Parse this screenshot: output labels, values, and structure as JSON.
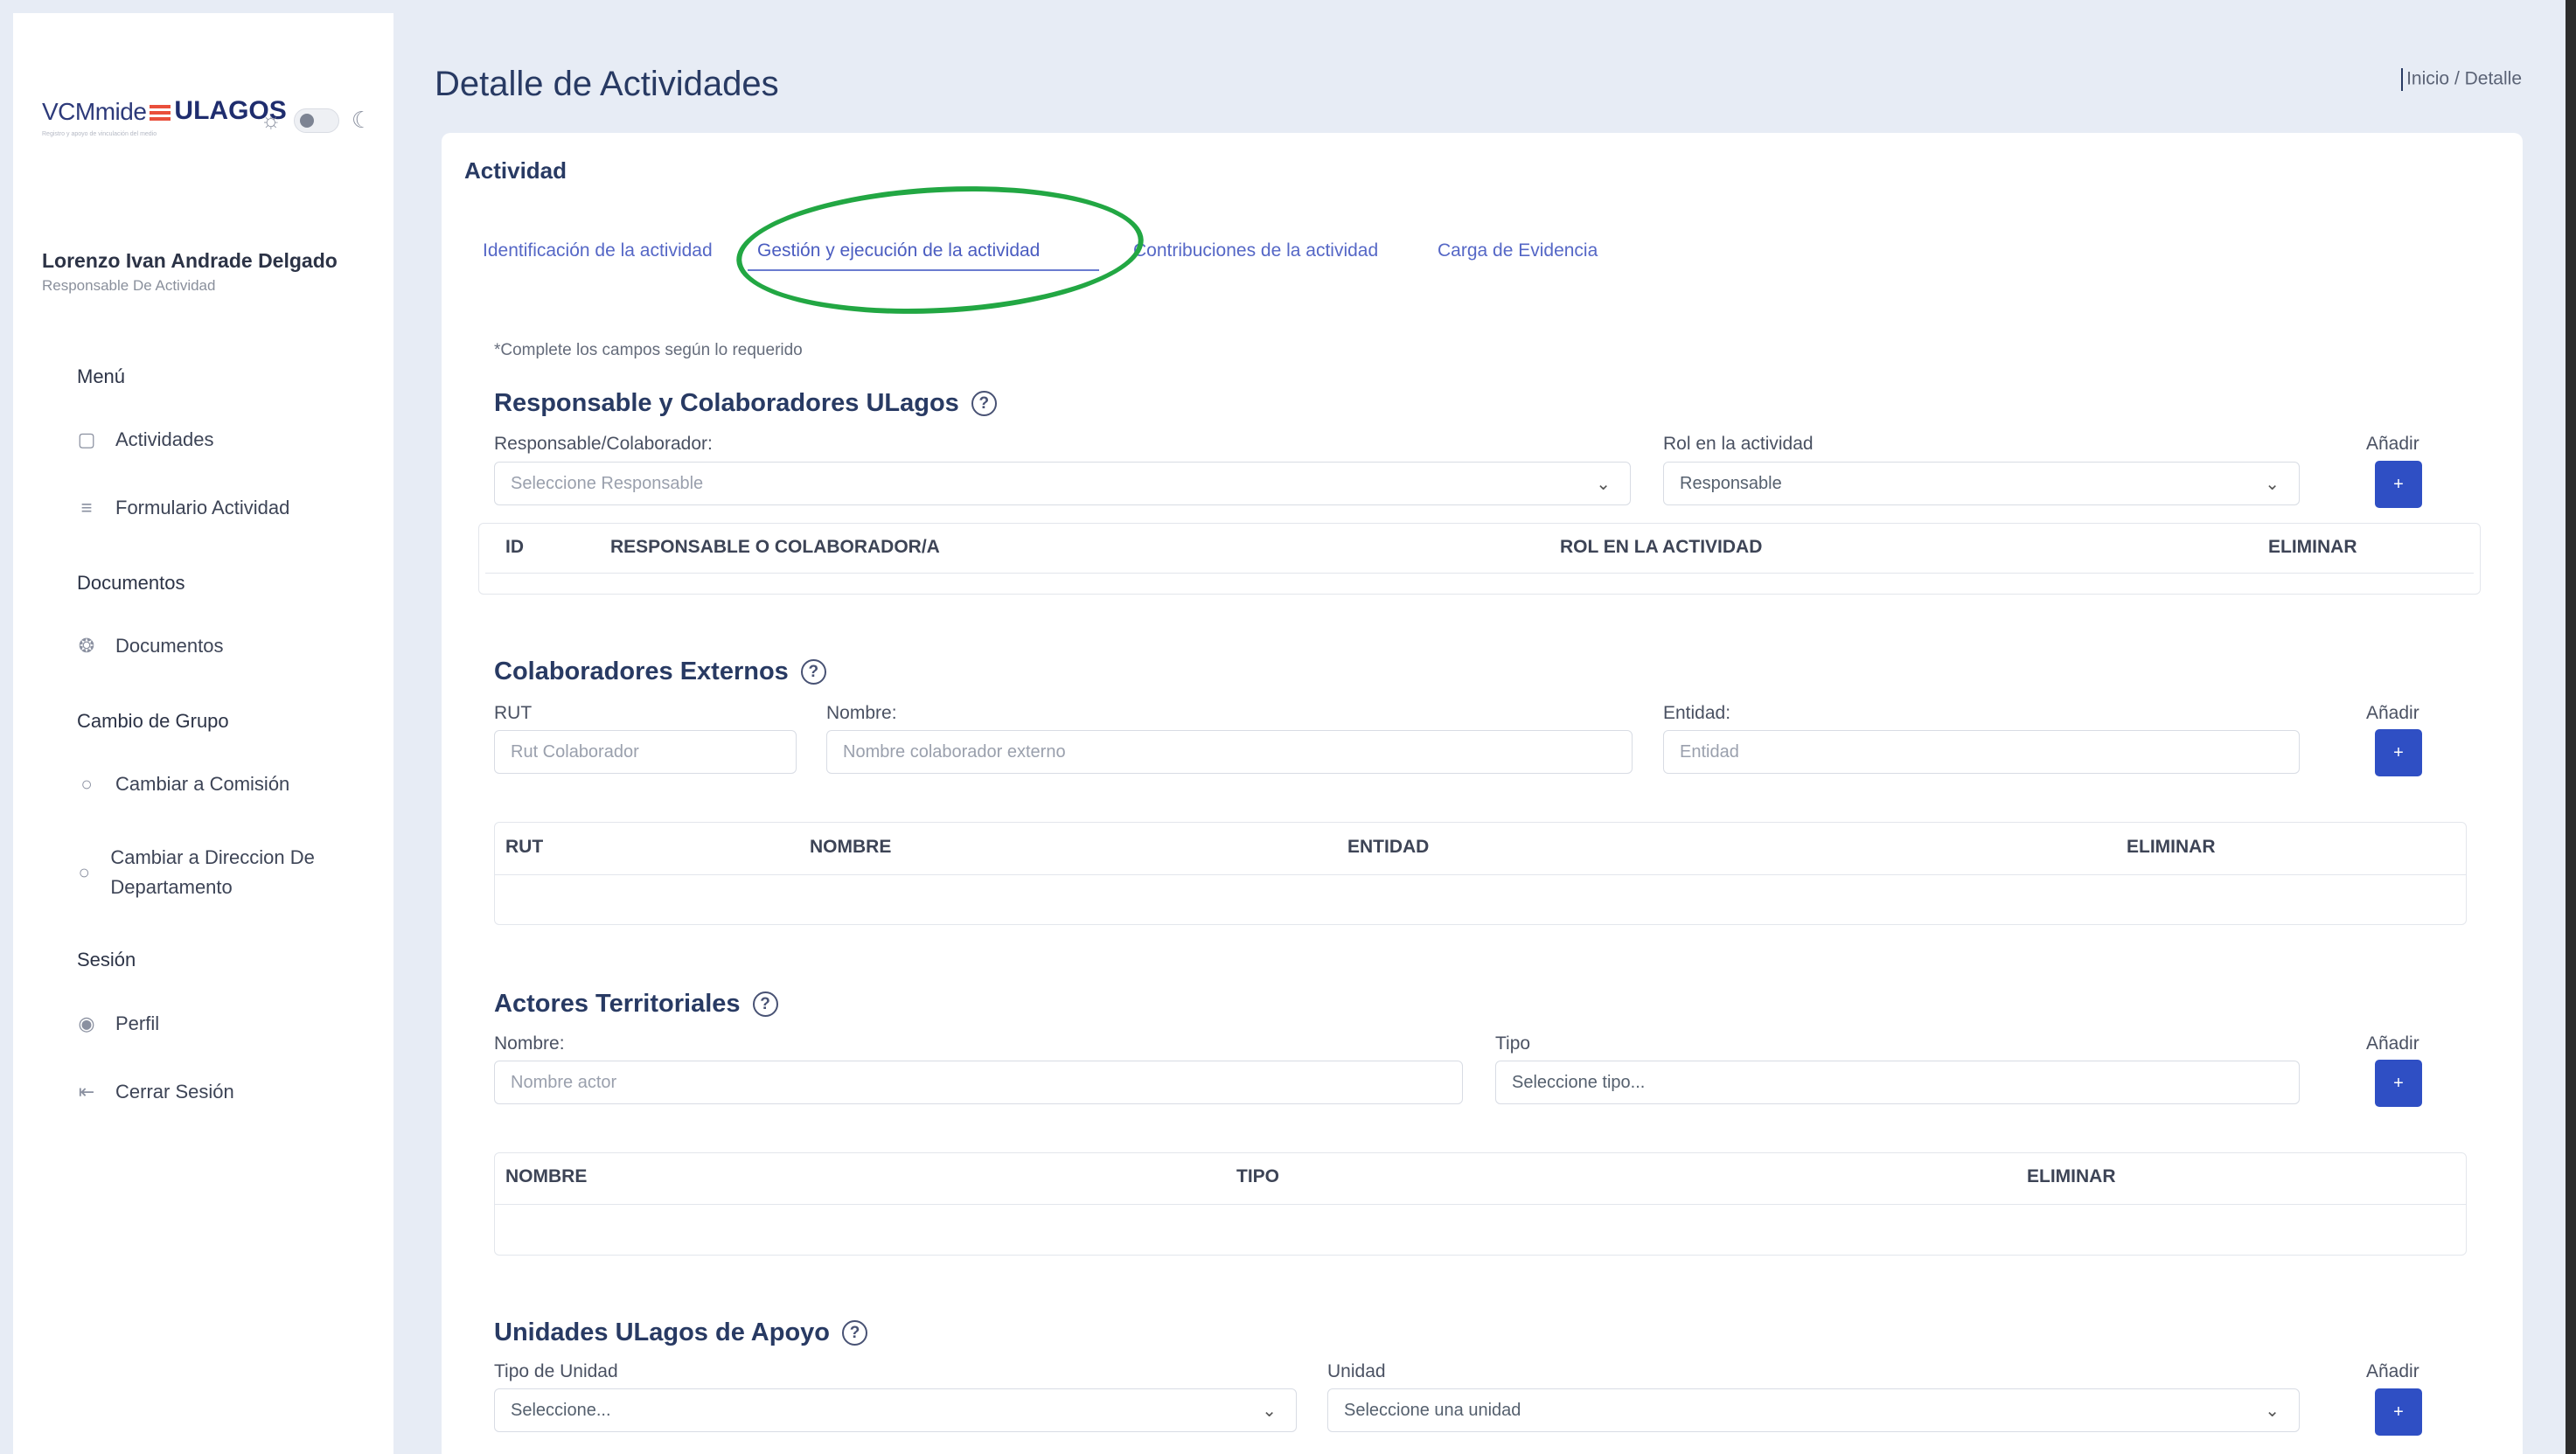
{
  "brand": {
    "prefix": "VCMmide",
    "name": "ULAGOS",
    "tagline": "Registro y apoyo de vinculación del medio"
  },
  "user": {
    "name": "Lorenzo Ivan Andrade Delgado",
    "role": "Responsable De Actividad"
  },
  "sidebar": {
    "menu_heading": "Menú",
    "activities": "Actividades",
    "activity_form": "Formulario Actividad",
    "docs_heading": "Documentos",
    "documents": "Documentos",
    "group_heading": "Cambio de Grupo",
    "to_commission": "Cambiar a Comisión",
    "to_department": "Cambiar a Direccion De Departamento",
    "session_heading": "Sesión",
    "profile": "Perfil",
    "logout": "Cerrar Sesión"
  },
  "page": {
    "title": "Detalle de Actividades",
    "breadcrumb_home": "Inicio",
    "breadcrumb_sep": "/",
    "breadcrumb_current": "Detalle"
  },
  "card": {
    "title": "Actividad"
  },
  "tabs": [
    {
      "label": "Identificación de la actividad"
    },
    {
      "label": "Gestión y ejecución de la actividad"
    },
    {
      "label": "Contribuciones de la actividad"
    },
    {
      "label": "Carga de Evidencia"
    }
  ],
  "hint": "*Complete los campos según lo requerido",
  "add_label": "Añadir",
  "add_symbol": "+",
  "responsables": {
    "title": "Responsable y Colaboradores ULagos",
    "field_label": "Responsable/Colaborador:",
    "field_placeholder": "Seleccione Responsable",
    "role_label": "Rol en la actividad",
    "role_value": "Responsable",
    "columns": [
      "ID",
      "RESPONSABLE O COLABORADOR/A",
      "ROL EN LA ACTIVIDAD",
      "ELIMINAR"
    ]
  },
  "externos": {
    "title": "Colaboradores Externos",
    "rut_label": "RUT",
    "rut_placeholder": "Rut Colaborador",
    "name_label": "Nombre:",
    "name_placeholder": "Nombre colaborador externo",
    "entity_label": "Entidad:",
    "entity_placeholder": "Entidad",
    "columns": [
      "RUT",
      "NOMBRE",
      "ENTIDAD",
      "ELIMINAR"
    ]
  },
  "actores": {
    "title": "Actores Territoriales",
    "name_label": "Nombre:",
    "name_placeholder": "Nombre actor",
    "type_label": "Tipo",
    "type_placeholder": "Seleccione tipo...",
    "columns": [
      "NOMBRE",
      "TIPO",
      "ELIMINAR"
    ]
  },
  "unidades": {
    "title": "Unidades ULagos de Apoyo",
    "type_label": "Tipo de Unidad",
    "type_placeholder": "Seleccione...",
    "unit_label": "Unidad",
    "unit_placeholder": "Seleccione una unidad"
  },
  "colors": {
    "accent": "#2f4fc4",
    "highlight_ring": "#22a743",
    "heading": "#283a63"
  }
}
